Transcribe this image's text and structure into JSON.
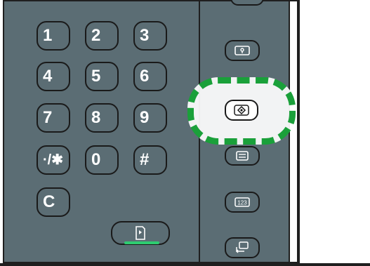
{
  "keypad": {
    "keys": [
      "1",
      "2",
      "3",
      "4",
      "5",
      "6",
      "7",
      "8",
      "9",
      "·/✱",
      "0",
      "#",
      "C"
    ]
  },
  "side_buttons": {
    "icons": [
      "key-icon",
      "check-status-icon",
      "display-icon",
      "counter-123-icon",
      "energy-saver-icon"
    ],
    "counter_text": "123"
  },
  "colors": {
    "panel": "#5b6d74",
    "border": "#1a1a1a",
    "highlight": "#1aa03a",
    "start_led": "#2ecc71"
  }
}
